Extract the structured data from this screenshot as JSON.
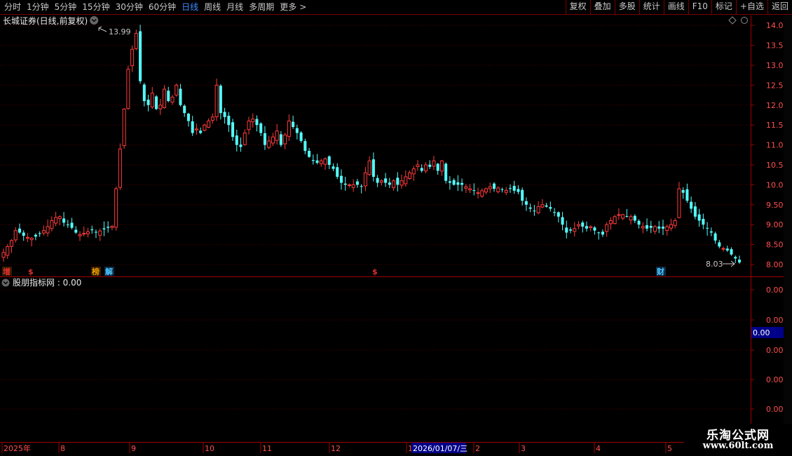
{
  "toolbar": {
    "periods": [
      {
        "label": "分时",
        "active": false
      },
      {
        "label": "1分钟",
        "active": false
      },
      {
        "label": "5分钟",
        "active": false
      },
      {
        "label": "15分钟",
        "active": false
      },
      {
        "label": "30分钟",
        "active": false
      },
      {
        "label": "60分钟",
        "active": false
      },
      {
        "label": "日线",
        "active": true
      },
      {
        "label": "周线",
        "active": false
      },
      {
        "label": "月线",
        "active": false
      },
      {
        "label": "多周期",
        "active": false
      },
      {
        "label": "更多",
        "active": false
      }
    ],
    "more_arrow": ">",
    "buttons": [
      "复权",
      "叠加",
      "多股",
      "统计",
      "画线",
      "F10",
      "标记",
      "+自选",
      "返回"
    ]
  },
  "main_chart": {
    "title": "长城证券(日线,前复权)",
    "high_label": "13.99",
    "low_label": "8.03",
    "y_ticks": [
      "14.00",
      "13.50",
      "13.00",
      "12.50",
      "12.00",
      "11.50",
      "11.00",
      "10.50",
      "10.00",
      "9.50",
      "9.00",
      "8.50",
      "8.00"
    ],
    "markers": [
      {
        "text": "增",
        "color": "#e03030"
      },
      {
        "text": "$",
        "color": "#e03030"
      },
      {
        "text": "榜",
        "color": "#e8a000"
      },
      {
        "text": "解",
        "color": "#4ec8ff"
      },
      {
        "text": "$",
        "color": "#e03030"
      },
      {
        "text": "财",
        "color": "#4ec8ff"
      }
    ]
  },
  "indicator": {
    "title": "股朋指标网 : 0.00",
    "y_ticks": [
      "0.00",
      "0.00",
      "0.00",
      "0.00",
      "0.00"
    ],
    "current_value": "0.00"
  },
  "date_axis": {
    "labels": [
      "2025年",
      "8",
      "9",
      "10",
      "11",
      "12",
      "1",
      "2",
      "3",
      "4",
      "5"
    ],
    "cursor_date": "2026/01/07/三"
  },
  "watermark": {
    "title": "乐淘公式网",
    "url": "www.60lt.com"
  },
  "colors": {
    "up": "#ff3b3b",
    "down": "#54ffff",
    "axis": "#a00000",
    "text": "#c8c8c8",
    "active_tab": "#3d8bff"
  },
  "chart_data": {
    "type": "candlestick",
    "y_unit": "price",
    "ylim": [
      7.7,
      14.25
    ],
    "x_start_month": "2025-07",
    "period": "daily",
    "series_close": [
      8.3,
      8.45,
      8.6,
      8.85,
      8.8,
      8.72,
      8.68,
      8.66,
      8.7,
      8.78,
      8.85,
      8.95,
      9.1,
      9.18,
      9.2,
      9.05,
      9.0,
      8.92,
      8.8,
      8.75,
      8.78,
      8.82,
      8.86,
      8.8,
      8.84,
      8.88,
      8.92,
      8.96,
      9.9,
      10.9,
      11.9,
      12.9,
      13.4,
      13.8,
      12.6,
      12.1,
      12.0,
      12.3,
      11.9,
      12.0,
      12.4,
      12.1,
      12.2,
      12.5,
      12.0,
      11.8,
      11.6,
      11.3,
      11.4,
      11.3,
      11.5,
      11.6,
      11.7,
      12.5,
      11.8,
      11.7,
      11.5,
      11.2,
      11.0,
      10.95,
      11.3,
      11.6,
      11.65,
      11.5,
      11.3,
      11.0,
      11.1,
      11.2,
      11.35,
      11.0,
      11.25,
      11.6,
      11.45,
      11.3,
      11.1,
      10.85,
      10.7,
      10.6,
      10.55,
      10.6,
      10.65,
      10.5,
      10.4,
      10.2,
      10.05,
      10.0,
      10.0,
      10.0,
      10.0,
      9.95,
      10.3,
      10.6,
      10.2,
      10.05,
      10.1,
      10.05,
      10.0,
      10.1,
      10.0,
      10.1,
      10.2,
      10.3,
      10.4,
      10.5,
      10.35,
      10.5,
      10.45,
      10.6,
      10.35,
      10.6,
      10.1,
      10.05,
      10.0,
      10.0,
      10.0,
      9.95,
      9.9,
      9.85,
      9.8,
      9.85,
      9.9,
      9.95,
      9.9,
      9.92,
      9.88,
      9.86,
      9.9,
      9.85,
      9.82,
      9.6,
      9.5,
      9.4,
      9.35,
      9.45,
      9.5,
      9.45,
      9.4,
      9.3,
      9.2,
      9.0,
      8.8,
      8.85,
      8.9,
      9.0,
      8.95,
      8.9,
      8.95,
      8.85,
      8.8,
      8.75,
      9.0,
      9.1,
      9.2,
      9.25,
      9.25,
      9.2,
      9.2,
      9.1,
      9.0,
      8.95,
      8.9,
      8.92,
      8.95,
      8.9,
      8.9,
      8.95,
      9.0,
      9.1,
      9.9,
      9.8,
      9.6,
      9.4,
      9.2,
      9.1,
      9.0,
      8.9,
      8.8,
      8.6,
      8.45,
      8.4,
      8.35,
      8.25,
      8.15,
      8.05
    ]
  }
}
